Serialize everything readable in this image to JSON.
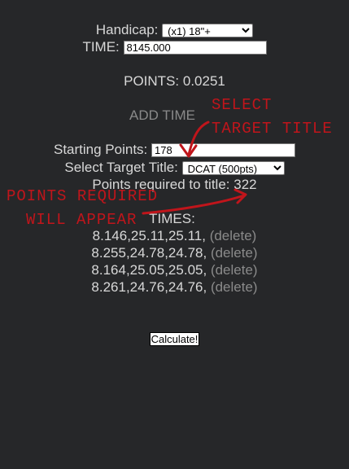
{
  "handicap": {
    "label": "Handicap:",
    "selected": "(x1) 18\"+"
  },
  "time": {
    "label": "TIME:",
    "value": "8145.000"
  },
  "points": {
    "label": "POINTS:",
    "value": "0.0251"
  },
  "add_time": {
    "label": "ADD TIME"
  },
  "starting_points": {
    "label": "Starting Points:",
    "value": "178"
  },
  "target_title": {
    "label": "Select Target Title:",
    "selected": "DCAT (500pts)"
  },
  "required": {
    "label": "Points required to title:",
    "value": "322"
  },
  "times": {
    "header": "TIMES:",
    "delete_label": "(delete)",
    "rows": [
      {
        "value": "8.146,25.11,25.11,"
      },
      {
        "value": "8.255,24.78,24.78,"
      },
      {
        "value": "8.164,25.05,25.05,"
      },
      {
        "value": "8.261,24.76,24.76,"
      }
    ]
  },
  "calculate": {
    "label": "Calculate!"
  },
  "annotations": {
    "select_target_line1": "SELECT",
    "select_target_line2": "TARGET TITLE",
    "points_required_line1": "POINTS REQUIRED",
    "points_required_line2": "WILL APPEAR",
    "color": "#c0151b"
  }
}
